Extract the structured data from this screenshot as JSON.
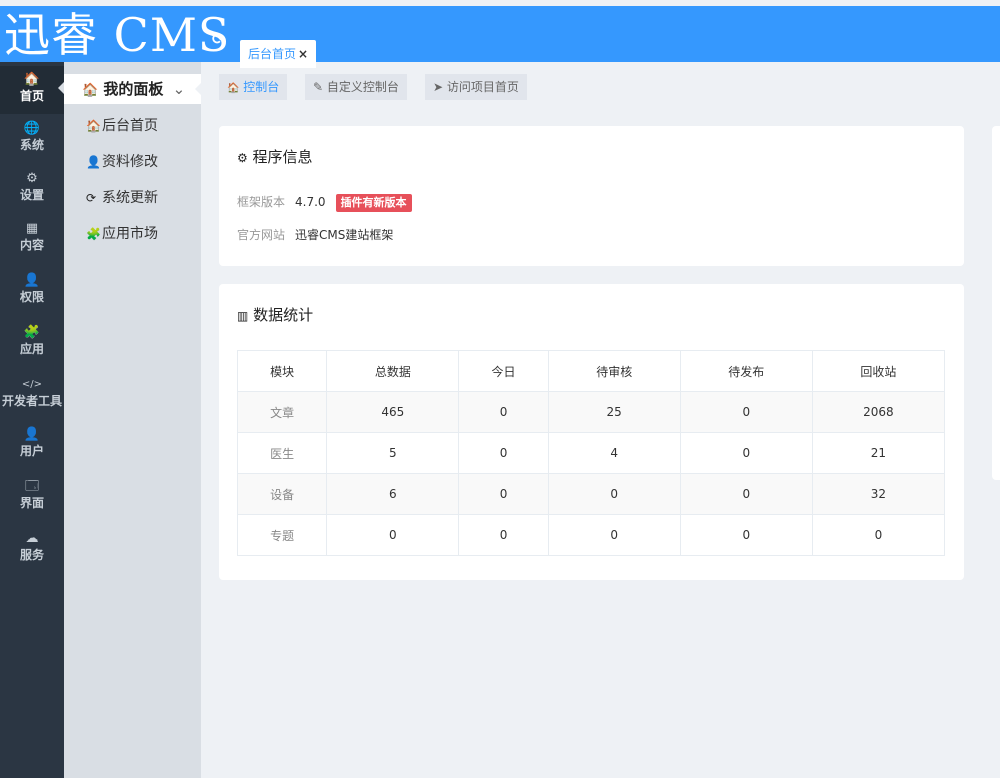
{
  "app": {
    "logo": "迅睿 CMS"
  },
  "top_tabs": [
    {
      "label": "后台首页",
      "close": "×"
    }
  ],
  "iconbar": [
    {
      "icon": "🏠",
      "label": "首页"
    },
    {
      "icon": "🌐",
      "label": "系统"
    },
    {
      "icon": "⚙",
      "label": "设置"
    },
    {
      "icon": "▦",
      "label": "内容"
    },
    {
      "icon": "👤",
      "label": "权限"
    },
    {
      "icon": "🧩",
      "label": "应用"
    },
    {
      "icon": "</>",
      "label": "开发者工具"
    },
    {
      "icon": "👤",
      "label": "用户"
    },
    {
      "icon": "🗔",
      "label": "界面"
    },
    {
      "icon": "☁",
      "label": "服务"
    }
  ],
  "subnav": {
    "header": "我的面板",
    "items": [
      {
        "icon": "🏠",
        "label": "后台首页"
      },
      {
        "icon": "👤",
        "label": "资料修改"
      },
      {
        "icon": "⟳",
        "label": "系统更新"
      },
      {
        "icon": "🧩",
        "label": "应用市场"
      }
    ]
  },
  "subtabs": [
    {
      "icon": "🏠",
      "label": "控制台"
    },
    {
      "icon": "✎",
      "label": "自定义控制台"
    },
    {
      "icon": "➤",
      "label": "访问项目首页"
    }
  ],
  "program_info": {
    "title": "程序信息",
    "version_label": "框架版本",
    "version": "4.7.0",
    "update_badge": "插件有新版本",
    "site_label": "官方网站",
    "site_value": "迅睿CMS建站框架"
  },
  "stats": {
    "title": "数据统计",
    "headers": [
      "模块",
      "总数据",
      "今日",
      "待审核",
      "待发布",
      "回收站"
    ],
    "rows": [
      [
        "文章",
        "465",
        "0",
        "25",
        "0",
        "2068"
      ],
      [
        "医生",
        "5",
        "0",
        "4",
        "0",
        "21"
      ],
      [
        "设备",
        "6",
        "0",
        "0",
        "0",
        "32"
      ],
      [
        "专题",
        "0",
        "0",
        "0",
        "0",
        "0"
      ]
    ]
  }
}
